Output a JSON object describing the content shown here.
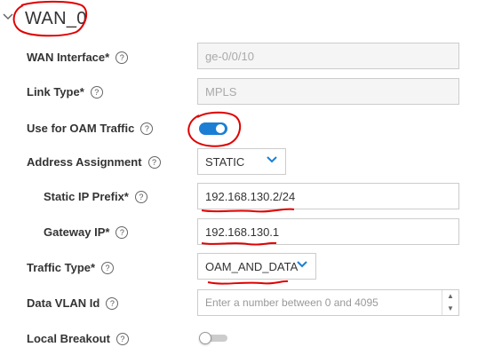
{
  "section": {
    "title": "WAN_0",
    "expand_icon": "chevron-down-icon"
  },
  "fields": {
    "wan_interface": {
      "label": "WAN Interface*",
      "value": "ge-0/0/10"
    },
    "link_type": {
      "label": "Link Type*",
      "value": "MPLS"
    },
    "use_for_oam": {
      "label": "Use for OAM Traffic",
      "enabled": true
    },
    "address_assignment": {
      "label": "Address Assignment",
      "value": "STATIC"
    },
    "static_ip_prefix": {
      "label": "Static IP Prefix*",
      "value": "192.168.130.2/24"
    },
    "gateway_ip": {
      "label": "Gateway IP*",
      "value": "192.168.130.1"
    },
    "traffic_type": {
      "label": "Traffic Type*",
      "value": "OAM_AND_DATA"
    },
    "data_vlan_id": {
      "label": "Data VLAN Id",
      "placeholder": "Enter a number between 0 and 4095"
    },
    "local_breakout": {
      "label": "Local Breakout",
      "enabled": false
    }
  },
  "icons": {
    "help": "?",
    "help_name": "help-circle-icon",
    "stepper_up": "▲",
    "stepper_down": "▼"
  },
  "colors": {
    "accent": "#1a7fd4",
    "annotation": "#e00000",
    "toggle_off": "#cccccc"
  }
}
